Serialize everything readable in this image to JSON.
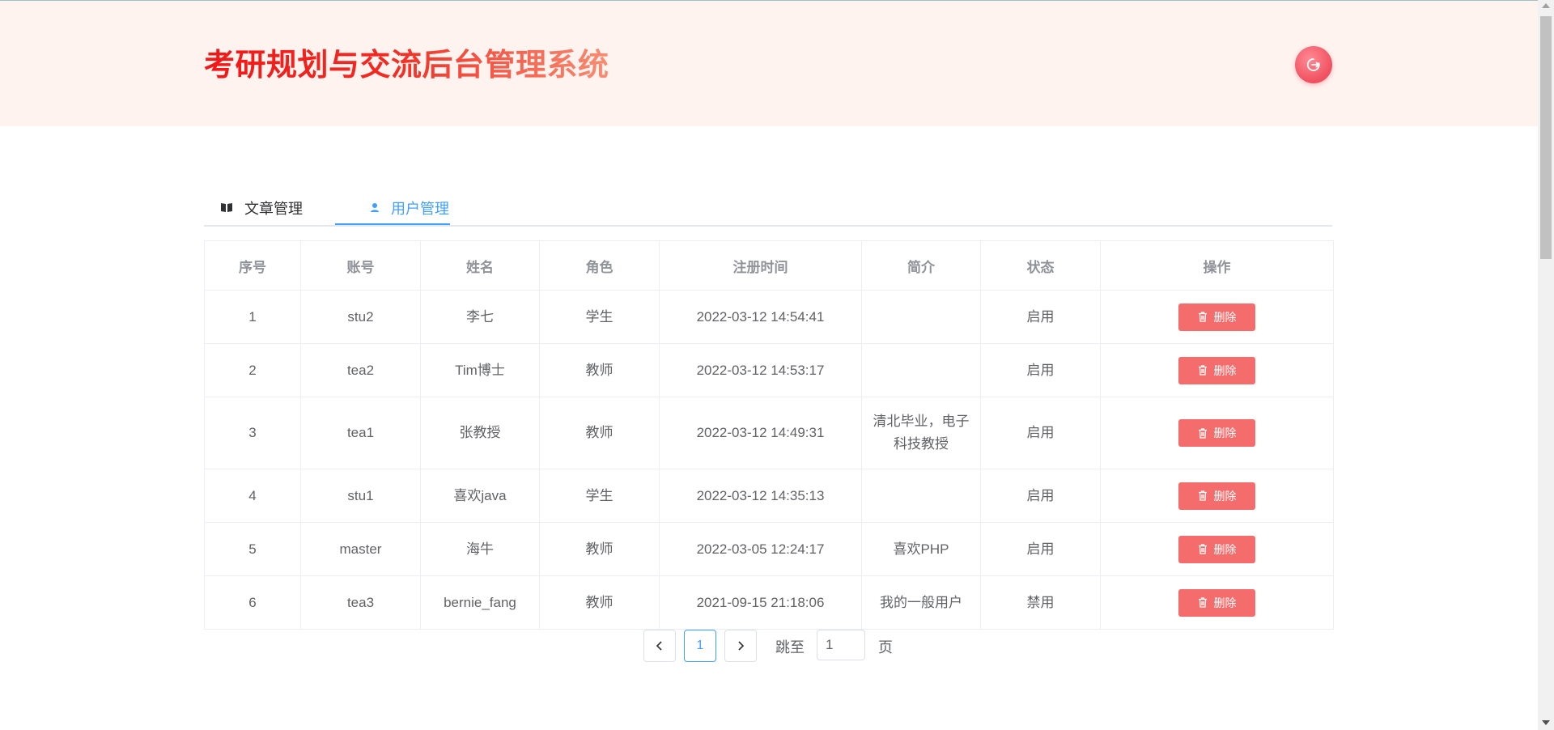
{
  "header": {
    "title": "考研规划与交流后台管理系统"
  },
  "tabs": [
    {
      "label": "文章管理",
      "icon": "book-icon"
    },
    {
      "label": "用户管理",
      "icon": "user-icon",
      "active": true
    }
  ],
  "table": {
    "columns": [
      "序号",
      "账号",
      "姓名",
      "角色",
      "注册时间",
      "简介",
      "状态",
      "操作"
    ],
    "delete_label": "删除",
    "rows": [
      {
        "index": "1",
        "account": "stu2",
        "name": "李七",
        "role": "学生",
        "registered": "2022-03-12 14:54:41",
        "bio": "",
        "status": "启用"
      },
      {
        "index": "2",
        "account": "tea2",
        "name": "Tim博士",
        "role": "教师",
        "registered": "2022-03-12 14:53:17",
        "bio": "",
        "status": "启用"
      },
      {
        "index": "3",
        "account": "tea1",
        "name": "张教授",
        "role": "教师",
        "registered": "2022-03-12 14:49:31",
        "bio": "清北毕业，电子科技教授",
        "status": "启用"
      },
      {
        "index": "4",
        "account": "stu1",
        "name": "喜欢java",
        "role": "学生",
        "registered": "2022-03-12 14:35:13",
        "bio": "",
        "status": "启用"
      },
      {
        "index": "5",
        "account": "master",
        "name": "海牛",
        "role": "教师",
        "registered": "2022-03-05 12:24:17",
        "bio": "喜欢PHP",
        "status": "启用"
      },
      {
        "index": "6",
        "account": "tea3",
        "name": "bernie_fang",
        "role": "教师",
        "registered": "2021-09-15 21:18:06",
        "bio": "我的一般用户",
        "status": "禁用"
      }
    ]
  },
  "pagination": {
    "current_page": "1",
    "jump_label": "跳至",
    "jump_value": "1",
    "page_suffix": "页"
  },
  "colors": {
    "primary": "#409eff",
    "danger": "#f56c6c",
    "status_on": "#2a9a2a",
    "status_off": "#f01a1a",
    "header_bg": "#fff3ef"
  }
}
